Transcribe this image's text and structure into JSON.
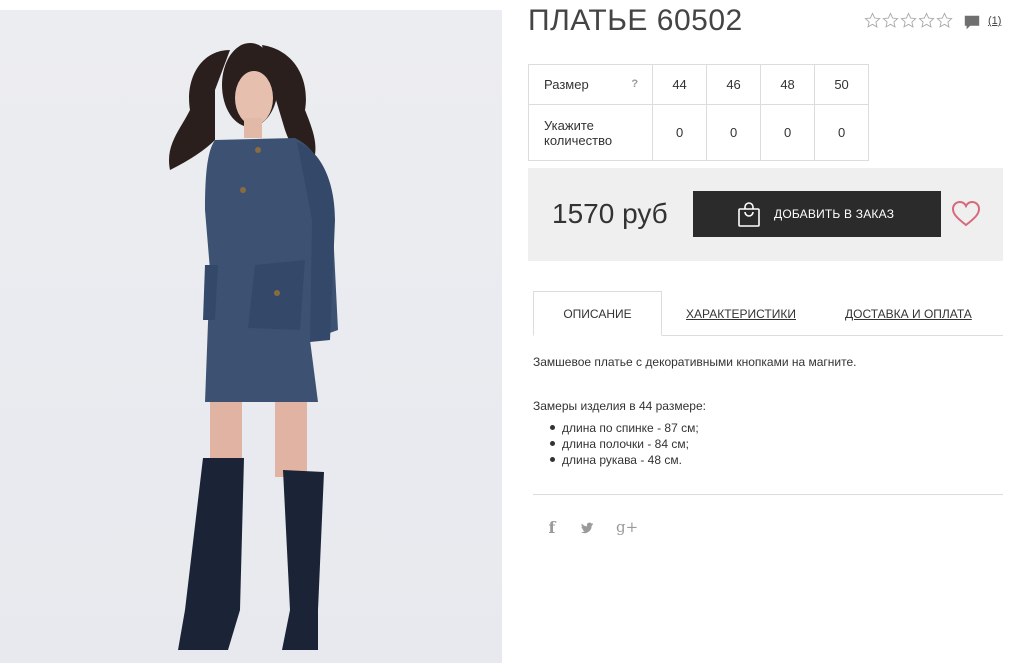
{
  "product": {
    "title": "ПЛАТЬЕ 60502",
    "image_alt": "product-photo-dress",
    "rating": {
      "stars_filled": 0,
      "stars_total": 5
    },
    "comments_count": "(1)"
  },
  "sizes": {
    "size_label": "Размер",
    "help_mark": "?",
    "qty_label": "Укажите количество",
    "columns": [
      "44",
      "46",
      "48",
      "50"
    ],
    "quantities": [
      "0",
      "0",
      "0",
      "0"
    ]
  },
  "purchase": {
    "price": "1570 руб",
    "order_button": "ДОБАВИТЬ В ЗАКАЗ"
  },
  "tabs": [
    {
      "label": "ОПИСАНИЕ",
      "active": true
    },
    {
      "label": "ХАРАКТЕРИСТИКИ",
      "active": false
    },
    {
      "label": "ДОСТАВКА И ОПЛАТА",
      "active": false
    }
  ],
  "description": {
    "text": "Замшевое платье с декоративными кнопками на магните.",
    "measure_title": "Замеры изделия в 44 размере:",
    "measures": [
      "длина по спинке - 87 см;",
      "длина полочки - 84 см;",
      "длина рукава - 48 см."
    ]
  },
  "social": {
    "facebook_glyph": "f",
    "twitter_glyph": "t",
    "gplus_glyph": "g+"
  },
  "colors": {
    "button_bg": "#2b2b2b",
    "price_box_bg": "#efefef",
    "heart_stroke": "#d76a7a",
    "dress": "#3d5272"
  }
}
